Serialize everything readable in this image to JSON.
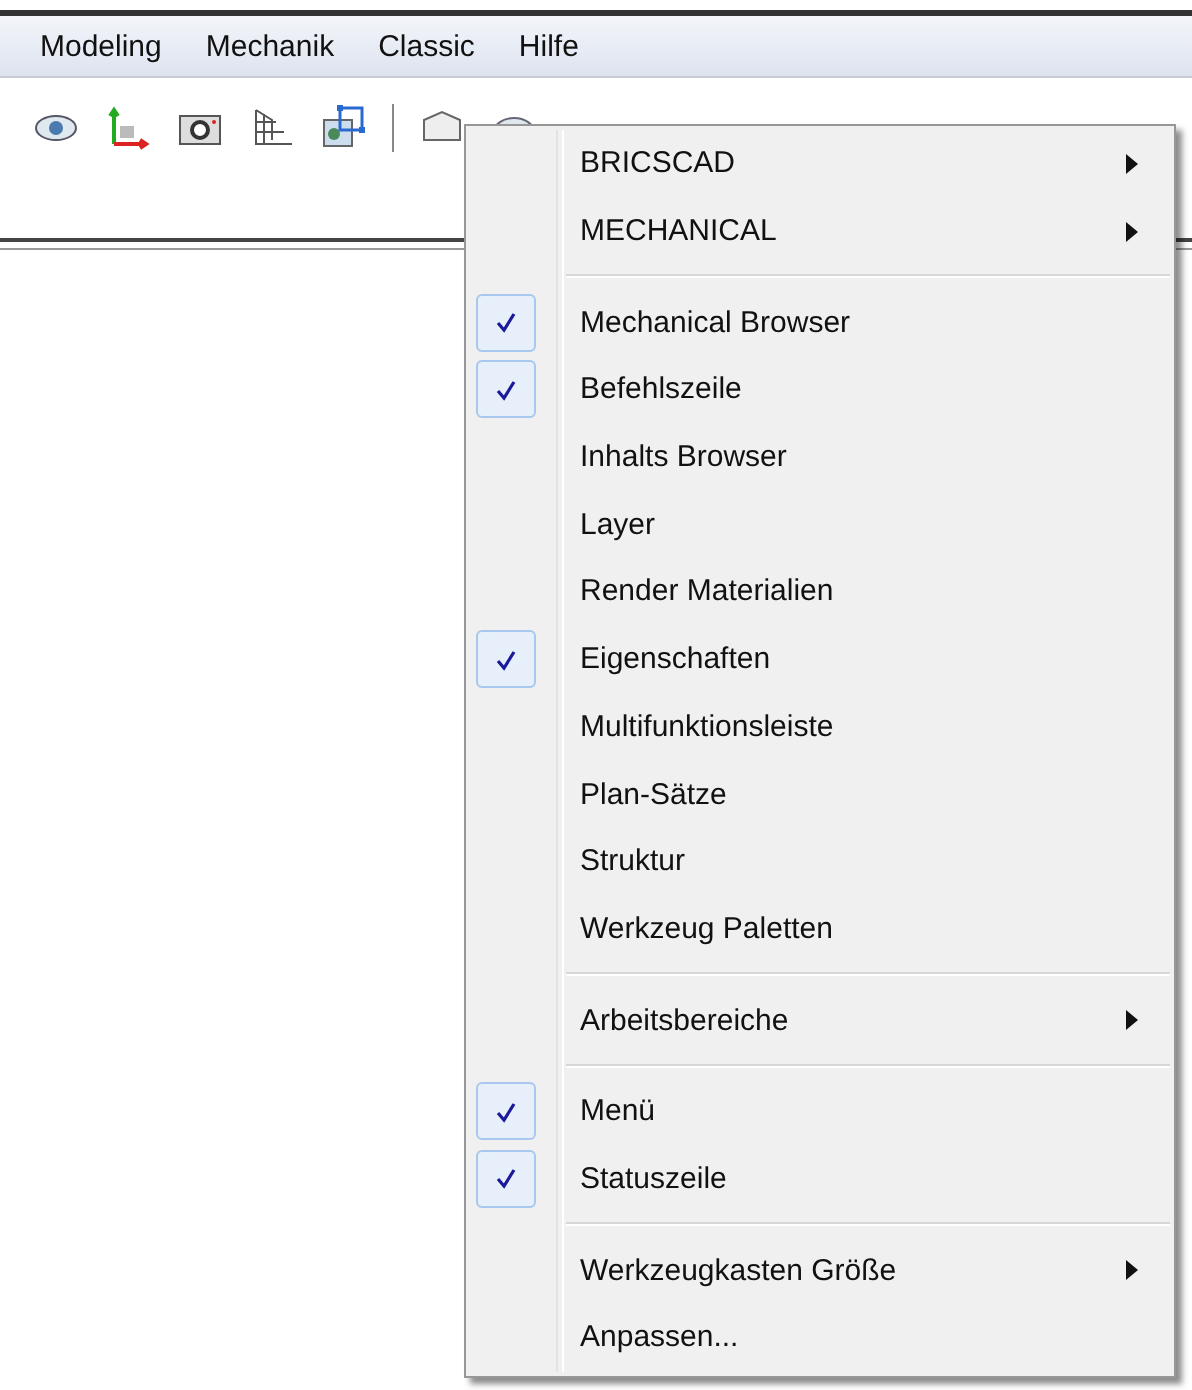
{
  "menu_bar": [
    {
      "label": "Modeling"
    },
    {
      "label": "Mechanik"
    },
    {
      "label": "Classic"
    },
    {
      "label": "Hilfe"
    }
  ],
  "context_menu": {
    "groups": [
      {
        "items": [
          {
            "label": "BRICSCAD",
            "checked": false,
            "submenu": true
          },
          {
            "label": "MECHANICAL",
            "checked": false,
            "submenu": true
          }
        ]
      },
      {
        "items": [
          {
            "label": "Mechanical Browser",
            "checked": true,
            "submenu": false
          },
          {
            "label": "Befehlszeile",
            "checked": true,
            "submenu": false
          },
          {
            "label": "Inhalts Browser",
            "checked": false,
            "submenu": false
          },
          {
            "label": "Layer",
            "checked": false,
            "submenu": false
          },
          {
            "label": "Render Materialien",
            "checked": false,
            "submenu": false
          },
          {
            "label": "Eigenschaften",
            "checked": true,
            "submenu": false
          },
          {
            "label": "Multifunktionsleiste",
            "checked": false,
            "submenu": false
          },
          {
            "label": "Plan-Sätze",
            "checked": false,
            "submenu": false
          },
          {
            "label": "Struktur",
            "checked": false,
            "submenu": false
          },
          {
            "label": "Werkzeug Paletten",
            "checked": false,
            "submenu": false
          }
        ]
      },
      {
        "items": [
          {
            "label": "Arbeitsbereiche",
            "checked": false,
            "submenu": true
          }
        ]
      },
      {
        "items": [
          {
            "label": "Menü",
            "checked": true,
            "submenu": false
          },
          {
            "label": "Statuszeile",
            "checked": true,
            "submenu": false
          }
        ]
      },
      {
        "items": [
          {
            "label": "Werkzeugkasten Größe",
            "checked": false,
            "submenu": true
          },
          {
            "label": "Anpassen...",
            "checked": false,
            "submenu": false
          }
        ]
      }
    ]
  }
}
